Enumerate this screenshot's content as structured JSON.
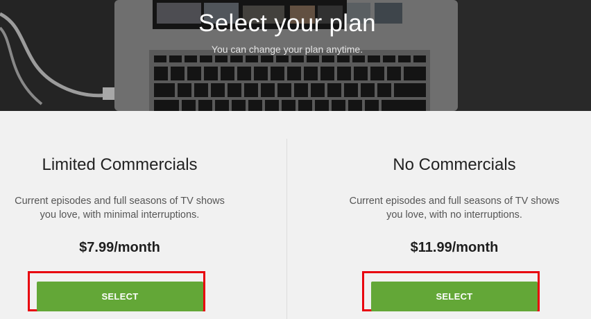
{
  "hero": {
    "title": "Select your plan",
    "subtitle": "You can change your plan anytime."
  },
  "plans": [
    {
      "name": "Limited Commercials",
      "description_line1": "Current episodes and full seasons of TV shows",
      "description_line2": "you love, with minimal interruptions.",
      "price": "$7.99/month",
      "button_label": "SELECT"
    },
    {
      "name": "No Commercials",
      "description_line1": "Current episodes and full seasons of TV shows",
      "description_line2": "you love, with no interruptions.",
      "price": "$11.99/month",
      "button_label": "SELECT"
    }
  ],
  "colors": {
    "select_button": "#63a737",
    "highlight_outline": "#e8000e",
    "background": "#f1f1f1"
  }
}
